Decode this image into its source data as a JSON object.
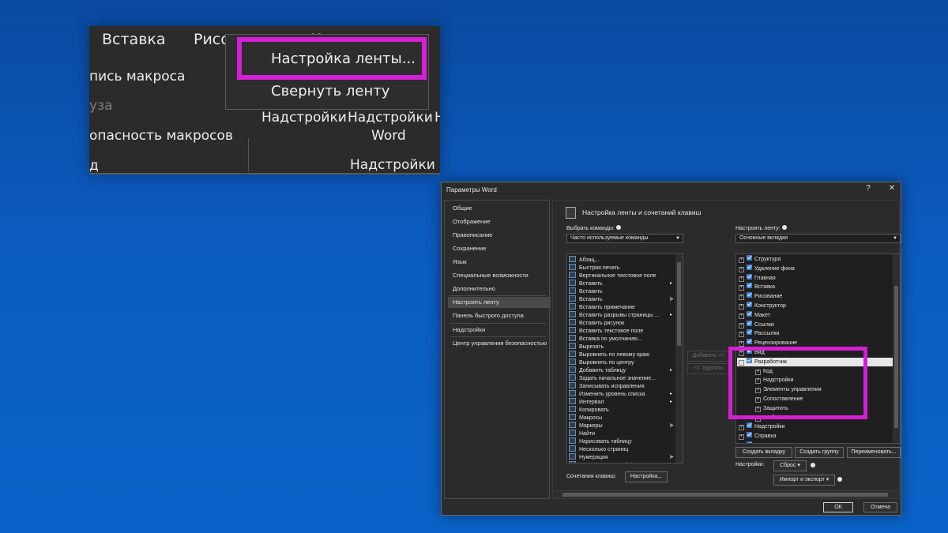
{
  "zoom": {
    "tabs": [
      "Вставка",
      "Рисо",
      "К"
    ],
    "groups": {
      "macro_record": "пись макроса",
      "pause": "уза",
      "macro_security": "опасность макросов",
      "addins1": "Надстройки",
      "addins2_line1": "Надстройки",
      "addins2_line2": "Word",
      "addins3": "Н",
      "group_label": "Надстройки",
      "cut": "д"
    },
    "context_menu": {
      "customize": "Настройка ленты...",
      "collapse": "Свернуть ленту"
    }
  },
  "dialog": {
    "title": "Параметры Word",
    "help": "?",
    "close": "✕",
    "nav": [
      "Общие",
      "Отображение",
      "Правописание",
      "Сохранение",
      "Язык",
      "Специальные возможности",
      "Дополнительно",
      "Настроить ленту",
      "Панель быстрого доступа",
      "Надстройки",
      "Центр управления безопасностью"
    ],
    "section_title": "Настройка ленты и сочетаний клавиш",
    "choose_commands_label": "Выбрать команды:",
    "choose_commands_value": "Часто используемые команды",
    "customize_ribbon_label": "Настроить ленту:",
    "customize_ribbon_value": "Основные вкладки",
    "commands": [
      "Абзац...",
      "Быстрая печать",
      "Вертикальное текстовое поле",
      "Вставить",
      "Вставить",
      "Вставить",
      "Вставить примечание",
      "Вставить разрывы страницы ...",
      "Вставить рисунок",
      "Вставить текстовое поле",
      "Вставка по умолчанию...",
      "Вырезать",
      "Выровнять по левому краю",
      "Выровнять по центру",
      "Добавить таблицу",
      "Задать начальное значение...",
      "Записывать исправления",
      "Изменить уровень списка",
      "Интервал",
      "Копировать",
      "Макросы",
      "Маркеры",
      "Найти",
      "Нарисовать таблицу",
      "Несколько страниц",
      "Нумерация",
      "Определить новый формат..."
    ],
    "add_button": "Добавить >>",
    "remove_button": "<< Удалить",
    "tree": [
      "Структура",
      "Удаление фона",
      "Главная",
      "Вставка",
      "Рисование",
      "Конструктор",
      "Макет",
      "Ссылки",
      "Рассылки",
      "Рецензирование",
      "Вид",
      "Разработчик",
      "Код",
      "Надстройки",
      "Элементы управления",
      "Сопоставление",
      "Защитить",
      "Шаблоны",
      "Надстройки",
      "Справка",
      "WPS PDF"
    ],
    "new_tab": "Создать вкладку",
    "new_group": "Создать группу",
    "rename": "Переименовать...",
    "settings_label": "Настройки:",
    "reset": "Сброс ▾",
    "import_export": "Импорт и экспорт ▾",
    "shortcuts_label": "Сочетания клавиш:",
    "shortcuts_button": "Настройка...",
    "ok": "ОК",
    "cancel": "Отмена"
  },
  "colors": {
    "highlight": "#d41fd4",
    "checkbox": "#3c7fd8",
    "background": "#0a5bbf"
  }
}
